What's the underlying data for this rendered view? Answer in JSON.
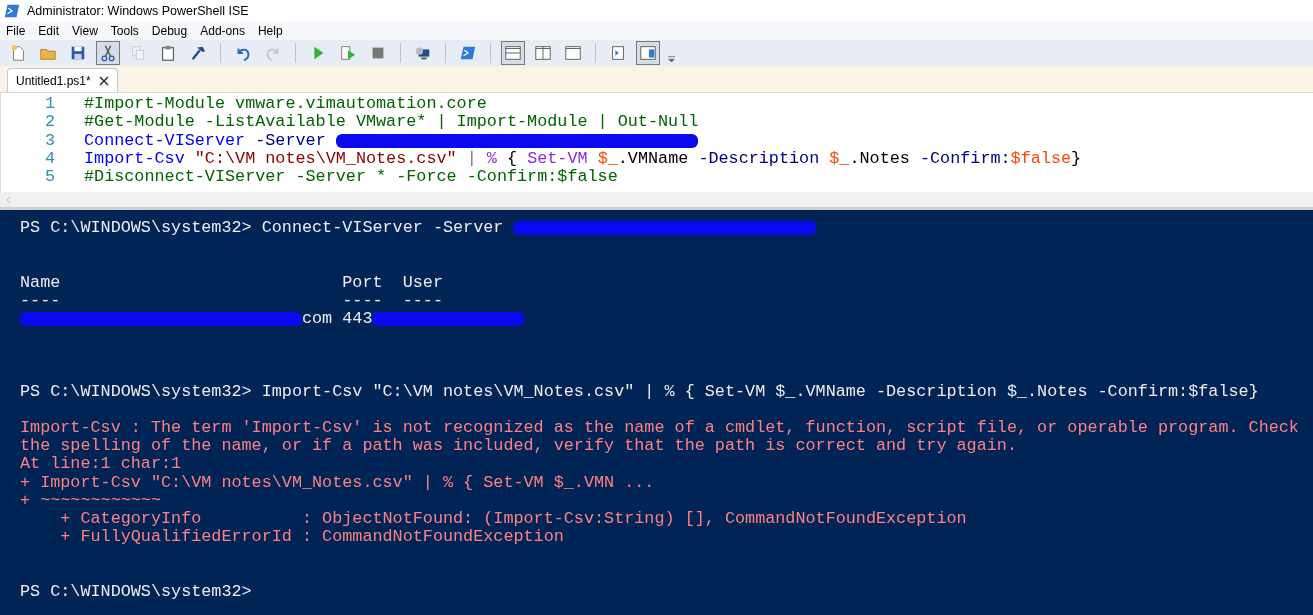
{
  "window": {
    "title": "Administrator: Windows PowerShell ISE"
  },
  "menu": [
    "File",
    "Edit",
    "View",
    "Tools",
    "Debug",
    "Add-ons",
    "Help"
  ],
  "toolbar": {
    "groups": [
      {
        "items": [
          {
            "pressed": false,
            "disabled": false
          },
          {
            "pressed": false,
            "disabled": false
          },
          {
            "pressed": false,
            "disabled": false
          },
          {
            "pressed": true,
            "disabled": false
          },
          {
            "pressed": false,
            "disabled": true
          },
          {
            "pressed": false,
            "disabled": false
          },
          {
            "pressed": false,
            "disabled": false
          }
        ]
      },
      {
        "items": [
          {
            "pressed": false,
            "disabled": false
          },
          {
            "pressed": false,
            "disabled": true
          }
        ]
      },
      {
        "items": [
          {
            "pressed": false,
            "disabled": false
          },
          {
            "pressed": false,
            "disabled": false
          },
          {
            "pressed": false,
            "disabled": false
          }
        ]
      },
      {
        "items": [
          {
            "pressed": false,
            "disabled": false
          }
        ]
      },
      {
        "items": [
          {
            "pressed": false,
            "disabled": false
          }
        ]
      },
      {
        "items": [
          {
            "pressed": true,
            "disabled": false
          },
          {
            "pressed": false,
            "disabled": false
          },
          {
            "pressed": false,
            "disabled": false
          }
        ]
      },
      {
        "items": [
          {
            "pressed": false,
            "disabled": false
          },
          {
            "pressed": true,
            "disabled": false
          }
        ]
      }
    ]
  },
  "tabs": [
    {
      "label": "Untitled1.ps1*",
      "selected": true
    }
  ],
  "editor": {
    "lines": [
      {
        "number": "1",
        "tokens": [
          {
            "kind": "comment",
            "text": "#Import-Module vmware.vimautomation.core"
          }
        ]
      },
      {
        "number": "2",
        "tokens": [
          {
            "kind": "comment",
            "text": "#Get-Module -ListAvailable VMware* | Import-Module | Out-Null"
          }
        ]
      },
      {
        "number": "3",
        "tokens": [
          {
            "kind": "command",
            "text": "Connect-VIServer "
          },
          {
            "kind": "parameter",
            "text": "-Server "
          },
          {
            "kind": "redaction"
          }
        ]
      },
      {
        "number": "4",
        "tokens": [
          {
            "kind": "command",
            "text": "Import-Csv "
          },
          {
            "kind": "string",
            "text": "\"C:\\VM notes\\VM_Notes.csv\""
          },
          {
            "kind": "operator",
            "text": " | "
          },
          {
            "kind": "alias",
            "text": "%"
          },
          {
            "kind": "plain",
            "text": " { "
          },
          {
            "kind": "alias",
            "text": "Set-VM "
          },
          {
            "kind": "variable",
            "text": "$_"
          },
          {
            "kind": "plain",
            "text": ".VMName "
          },
          {
            "kind": "parameter",
            "text": "-Description "
          },
          {
            "kind": "variable",
            "text": "$_"
          },
          {
            "kind": "plain",
            "text": ".Notes "
          },
          {
            "kind": "parameter",
            "text": "-Confirm:"
          },
          {
            "kind": "variable",
            "text": "$false"
          },
          {
            "kind": "plain",
            "text": "}"
          }
        ]
      },
      {
        "number": "5",
        "tokens": [
          {
            "kind": "comment",
            "text": "#Disconnect-VIServer -Server * -Force -Confirm:$false"
          }
        ]
      }
    ]
  },
  "console": {
    "blocks": [
      {
        "kind": "output",
        "lines": [
          [
            {
              "kind": "text",
              "text": "PS C:\\WINDOWS\\system32> Connect-VIServer -Server "
            },
            {
              "kind": "redaction"
            }
          ]
        ]
      },
      {
        "kind": "output",
        "lines": [
          [
            {
              "kind": "text",
              "text": "Name                            Port  User"
            }
          ]
        ]
      },
      {
        "kind": "output",
        "lines": [
          [
            {
              "kind": "text",
              "text": "----                            ----  ----"
            }
          ]
        ]
      },
      {
        "kind": "output",
        "lines": [
          [
            {
              "kind": "redaction"
            },
            {
              "kind": "text",
              "text": "com 443"
            },
            {
              "kind": "redaction"
            }
          ]
        ]
      },
      {
        "kind": "output",
        "lines": [
          [
            {
              "kind": "text",
              "text": "PS C:\\WINDOWS\\system32> Import-Csv \"C:\\VM notes\\VM_Notes.csv\" | % { Set-VM $_.VMName -Description $_.Notes -Confirm:$false}"
            }
          ]
        ]
      },
      {
        "kind": "error",
        "lines": [
          [
            {
              "kind": "text",
              "text": "Import-Csv : The term 'Import-Csv' is not recognized as the name of a cmdlet, function, script file, or operable program. Check"
            }
          ],
          [
            {
              "kind": "text",
              "text": "the spelling of the name, or if a path was included, verify that the path is correct and try again."
            }
          ],
          [
            {
              "kind": "text",
              "text": "At line:1 char:1"
            }
          ],
          [
            {
              "kind": "text",
              "text": "+ Import-Csv \"C:\\VM notes\\VM_Notes.csv\" | % { Set-VM $_.VMN ..."
            }
          ],
          [
            {
              "kind": "text",
              "text": "+ ~~~~~~~~~~~~"
            }
          ],
          [
            {
              "kind": "text",
              "text": "    + CategoryInfo          : ObjectNotFound: (Import-Csv:String) [], CommandNotFoundException"
            }
          ],
          [
            {
              "kind": "text",
              "text": "    + FullyQualifiedErrorId : CommandNotFoundException"
            }
          ]
        ]
      },
      {
        "kind": "output",
        "lines": [
          [
            {
              "kind": "text",
              "text": "PS C:\\WINDOWS\\system32>"
            }
          ]
        ]
      }
    ]
  }
}
